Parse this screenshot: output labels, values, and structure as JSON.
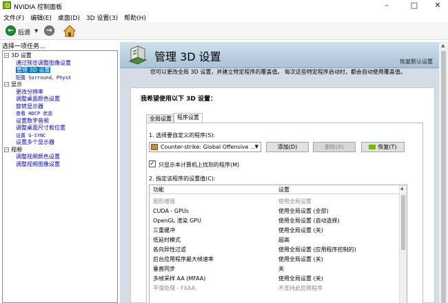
{
  "window": {
    "title": "NVIDIA 控制面板",
    "minimize": "–",
    "maximize": "□",
    "close": "✕"
  },
  "menu": [
    "文件(F)",
    "编辑(E)",
    "桌面(D)",
    "3D 设置(3)",
    "帮助(H)"
  ],
  "toolbar": {
    "back_label": "后退"
  },
  "sidebar": {
    "header": "选择一项任务...",
    "tree": [
      {
        "label": "3D 设置",
        "items": [
          {
            "label": "通过预览调整图像设置",
            "selected": false
          },
          {
            "label": "管理 3D 设置",
            "selected": true
          },
          {
            "label": "配置 Surround、PhysX",
            "selected": false
          }
        ]
      },
      {
        "label": "显示",
        "items": [
          {
            "label": "更改分辨率"
          },
          {
            "label": "调整桌面颜色设置"
          },
          {
            "label": "旋转显示器"
          },
          {
            "label": "查看 HDCP 状态"
          },
          {
            "label": "设置数字音频"
          },
          {
            "label": "调整桌面尺寸和位置"
          },
          {
            "label": "设置 G-SYNC"
          },
          {
            "label": "设置多个显示器"
          }
        ]
      },
      {
        "label": "视频",
        "items": [
          {
            "label": "调整视频颜色设置"
          },
          {
            "label": "调整视频图像设置"
          }
        ]
      }
    ]
  },
  "header": {
    "title": "管理 3D 设置",
    "restore_defaults": "恢复默认设置"
  },
  "main": {
    "intro": "您可以更改全局 3D 设置，并建立特定程序的覆盖值。  每次这些特定程序启动时，都会自动使用覆盖值。",
    "panel_heading": "我希望使用以下 3D 设置：",
    "tabs": [
      {
        "label": "全局设置",
        "active": false
      },
      {
        "label": "程序设置",
        "active": true
      }
    ],
    "step1_label": "1. 选择要自定义的程序(S):",
    "program": "Counter-strike: Global Offensive ...",
    "add_button": "添加(D)",
    "remove_button": "删除(R)",
    "restore_button": "恢复(T)",
    "checkbox_label": "只显示本计算机上找到的程序(M)",
    "checkbox_checked": true,
    "step2_label": "2. 指定该程序的设置值(C):",
    "columns": [
      "功能",
      "设置"
    ],
    "rows": [
      {
        "feature": "图形增强",
        "setting": "使用全局设置",
        "dim": true
      },
      {
        "feature": "CUDA - GPUs",
        "setting": "使用全局设置 (全部)",
        "dim": false
      },
      {
        "feature": "OpenGL 渲染 GPU",
        "setting": "使用全局设置 (自动选择)",
        "dim": false
      },
      {
        "feature": "三重缓冲",
        "setting": "使用全局设置 (关)",
        "dim": false
      },
      {
        "feature": "低延时模式",
        "setting": "超高",
        "dim": false
      },
      {
        "feature": "各向异性过滤",
        "setting": "使用全局设置 (应用程序控制的)",
        "dim": false
      },
      {
        "feature": "后台应用程序最大帧速率",
        "setting": "使用全局设置 (关)",
        "dim": false
      },
      {
        "feature": "垂直同步",
        "setting": "关",
        "dim": false
      },
      {
        "feature": "多帧采样 AA (MFAA)",
        "setting": "使用全局设置 (关)",
        "dim": false
      },
      {
        "feature": "平滑处理 - FXAA",
        "setting": "不支持此应用程序",
        "dim": true
      }
    ]
  }
}
